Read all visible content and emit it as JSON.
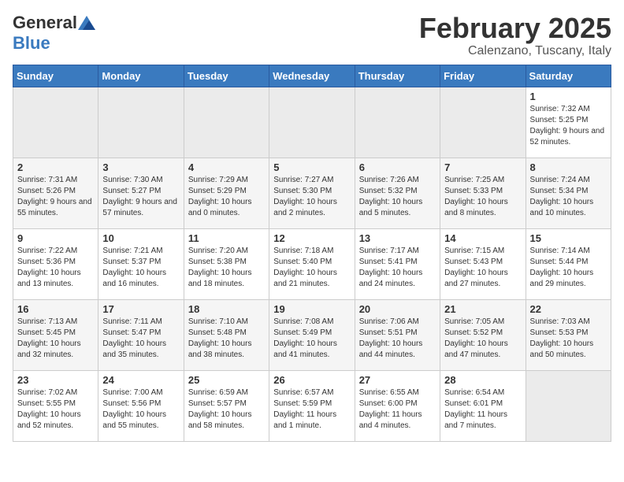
{
  "header": {
    "logo_general": "General",
    "logo_blue": "Blue",
    "month_title": "February 2025",
    "location": "Calenzano, Tuscany, Italy"
  },
  "weekdays": [
    "Sunday",
    "Monday",
    "Tuesday",
    "Wednesday",
    "Thursday",
    "Friday",
    "Saturday"
  ],
  "weeks": [
    [
      {
        "day": "",
        "info": "",
        "empty": true
      },
      {
        "day": "",
        "info": "",
        "empty": true
      },
      {
        "day": "",
        "info": "",
        "empty": true
      },
      {
        "day": "",
        "info": "",
        "empty": true
      },
      {
        "day": "",
        "info": "",
        "empty": true
      },
      {
        "day": "",
        "info": "",
        "empty": true
      },
      {
        "day": "1",
        "info": "Sunrise: 7:32 AM\nSunset: 5:25 PM\nDaylight: 9 hours and 52 minutes.",
        "empty": false
      }
    ],
    [
      {
        "day": "2",
        "info": "Sunrise: 7:31 AM\nSunset: 5:26 PM\nDaylight: 9 hours and 55 minutes.",
        "empty": false
      },
      {
        "day": "3",
        "info": "Sunrise: 7:30 AM\nSunset: 5:27 PM\nDaylight: 9 hours and 57 minutes.",
        "empty": false
      },
      {
        "day": "4",
        "info": "Sunrise: 7:29 AM\nSunset: 5:29 PM\nDaylight: 10 hours and 0 minutes.",
        "empty": false
      },
      {
        "day": "5",
        "info": "Sunrise: 7:27 AM\nSunset: 5:30 PM\nDaylight: 10 hours and 2 minutes.",
        "empty": false
      },
      {
        "day": "6",
        "info": "Sunrise: 7:26 AM\nSunset: 5:32 PM\nDaylight: 10 hours and 5 minutes.",
        "empty": false
      },
      {
        "day": "7",
        "info": "Sunrise: 7:25 AM\nSunset: 5:33 PM\nDaylight: 10 hours and 8 minutes.",
        "empty": false
      },
      {
        "day": "8",
        "info": "Sunrise: 7:24 AM\nSunset: 5:34 PM\nDaylight: 10 hours and 10 minutes.",
        "empty": false
      }
    ],
    [
      {
        "day": "9",
        "info": "Sunrise: 7:22 AM\nSunset: 5:36 PM\nDaylight: 10 hours and 13 minutes.",
        "empty": false
      },
      {
        "day": "10",
        "info": "Sunrise: 7:21 AM\nSunset: 5:37 PM\nDaylight: 10 hours and 16 minutes.",
        "empty": false
      },
      {
        "day": "11",
        "info": "Sunrise: 7:20 AM\nSunset: 5:38 PM\nDaylight: 10 hours and 18 minutes.",
        "empty": false
      },
      {
        "day": "12",
        "info": "Sunrise: 7:18 AM\nSunset: 5:40 PM\nDaylight: 10 hours and 21 minutes.",
        "empty": false
      },
      {
        "day": "13",
        "info": "Sunrise: 7:17 AM\nSunset: 5:41 PM\nDaylight: 10 hours and 24 minutes.",
        "empty": false
      },
      {
        "day": "14",
        "info": "Sunrise: 7:15 AM\nSunset: 5:43 PM\nDaylight: 10 hours and 27 minutes.",
        "empty": false
      },
      {
        "day": "15",
        "info": "Sunrise: 7:14 AM\nSunset: 5:44 PM\nDaylight: 10 hours and 29 minutes.",
        "empty": false
      }
    ],
    [
      {
        "day": "16",
        "info": "Sunrise: 7:13 AM\nSunset: 5:45 PM\nDaylight: 10 hours and 32 minutes.",
        "empty": false
      },
      {
        "day": "17",
        "info": "Sunrise: 7:11 AM\nSunset: 5:47 PM\nDaylight: 10 hours and 35 minutes.",
        "empty": false
      },
      {
        "day": "18",
        "info": "Sunrise: 7:10 AM\nSunset: 5:48 PM\nDaylight: 10 hours and 38 minutes.",
        "empty": false
      },
      {
        "day": "19",
        "info": "Sunrise: 7:08 AM\nSunset: 5:49 PM\nDaylight: 10 hours and 41 minutes.",
        "empty": false
      },
      {
        "day": "20",
        "info": "Sunrise: 7:06 AM\nSunset: 5:51 PM\nDaylight: 10 hours and 44 minutes.",
        "empty": false
      },
      {
        "day": "21",
        "info": "Sunrise: 7:05 AM\nSunset: 5:52 PM\nDaylight: 10 hours and 47 minutes.",
        "empty": false
      },
      {
        "day": "22",
        "info": "Sunrise: 7:03 AM\nSunset: 5:53 PM\nDaylight: 10 hours and 50 minutes.",
        "empty": false
      }
    ],
    [
      {
        "day": "23",
        "info": "Sunrise: 7:02 AM\nSunset: 5:55 PM\nDaylight: 10 hours and 52 minutes.",
        "empty": false
      },
      {
        "day": "24",
        "info": "Sunrise: 7:00 AM\nSunset: 5:56 PM\nDaylight: 10 hours and 55 minutes.",
        "empty": false
      },
      {
        "day": "25",
        "info": "Sunrise: 6:59 AM\nSunset: 5:57 PM\nDaylight: 10 hours and 58 minutes.",
        "empty": false
      },
      {
        "day": "26",
        "info": "Sunrise: 6:57 AM\nSunset: 5:59 PM\nDaylight: 11 hours and 1 minute.",
        "empty": false
      },
      {
        "day": "27",
        "info": "Sunrise: 6:55 AM\nSunset: 6:00 PM\nDaylight: 11 hours and 4 minutes.",
        "empty": false
      },
      {
        "day": "28",
        "info": "Sunrise: 6:54 AM\nSunset: 6:01 PM\nDaylight: 11 hours and 7 minutes.",
        "empty": false
      },
      {
        "day": "",
        "info": "",
        "empty": true
      }
    ]
  ]
}
